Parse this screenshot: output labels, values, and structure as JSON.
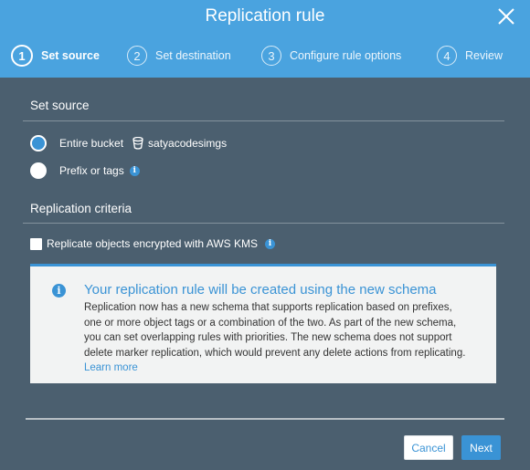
{
  "dialog": {
    "title": "Replication rule"
  },
  "steps": [
    {
      "number": "1",
      "label": "Set source",
      "active": true
    },
    {
      "number": "2",
      "label": "Set destination",
      "active": false
    },
    {
      "number": "3",
      "label": "Configure rule options",
      "active": false
    },
    {
      "number": "4",
      "label": "Review",
      "active": false
    }
  ],
  "source": {
    "heading": "Set source",
    "entire_bucket_label": "Entire bucket",
    "bucket_name": "satyacodesimgs",
    "prefix_label": "Prefix or tags",
    "selected": "entire_bucket"
  },
  "criteria": {
    "heading": "Replication criteria",
    "kms_label": "Replicate objects encrypted with AWS KMS",
    "kms_checked": false
  },
  "alert": {
    "heading": "Your replication rule will be created using the new schema",
    "lines": [
      "Replication now has a new schema that supports replication based on prefixes,",
      "one or more object tags or a combination of the two. As part of the new schema,",
      "you can set overlapping rules with priorities. The new schema does not support",
      "delete marker replication, which would prevent any delete actions from replicating."
    ],
    "link_text": "Learn more"
  },
  "footer": {
    "cancel_label": "Cancel",
    "next_label": "Next"
  },
  "colors": {
    "header_bg": "#4aa3df",
    "body_bg": "#4b5f6f",
    "accent": "#3a93d5",
    "alert_bg": "#f2f3f3"
  }
}
